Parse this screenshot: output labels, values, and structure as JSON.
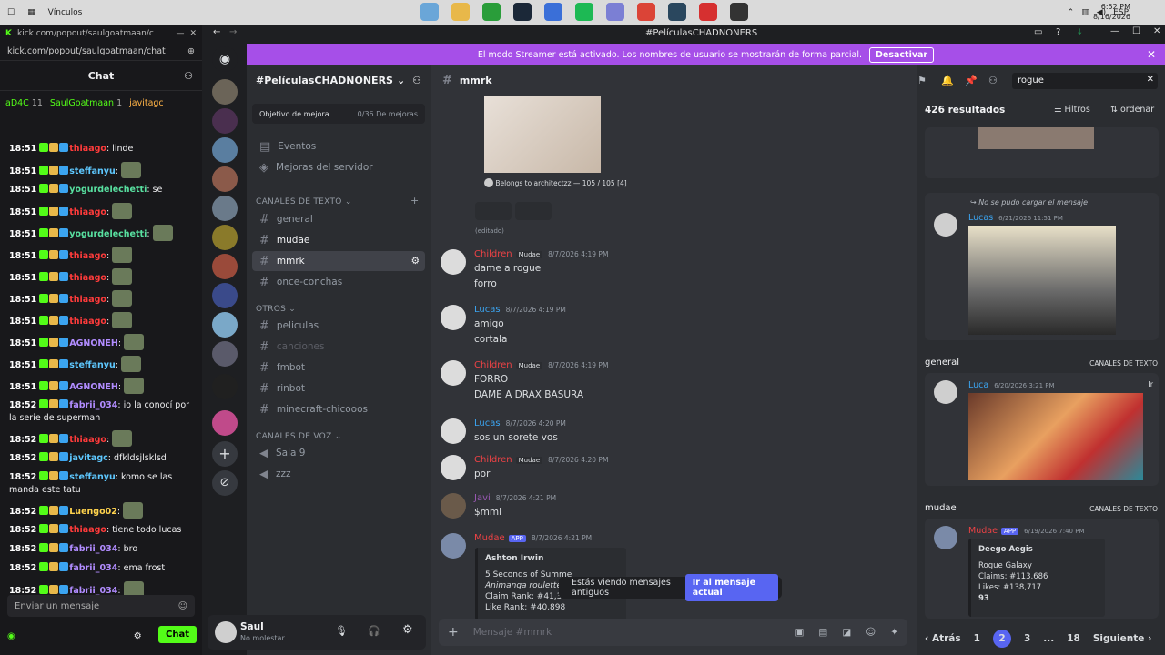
{
  "taskbar": {
    "links_label": "Vínculos",
    "lang": "ESP",
    "time": "6:52 PM",
    "date": "8/16/2026",
    "apps": [
      {
        "name": "photos",
        "color": "#6aa6d8"
      },
      {
        "name": "files",
        "color": "#e8b84a"
      },
      {
        "name": "xbox",
        "color": "#2a9d3a"
      },
      {
        "name": "steam",
        "color": "#1b2838"
      },
      {
        "name": "vpn",
        "color": "#3a6fd8"
      },
      {
        "name": "spotify",
        "color": "#1db954"
      },
      {
        "name": "discord",
        "color": "#7b7fd4"
      },
      {
        "name": "chrome",
        "color": "#db4437"
      },
      {
        "name": "steam2",
        "color": "#2a475e"
      },
      {
        "name": "app-red",
        "color": "#d63030"
      },
      {
        "name": "app-dark",
        "color": "#333333"
      }
    ]
  },
  "kick": {
    "url": "kick.com/popout/saulgoatmaan/chat",
    "header": "Chat",
    "pinned": [
      {
        "name": "aD4C",
        "count": "11"
      },
      {
        "name": "SaulGoatmaan",
        "count": "1"
      },
      {
        "name": "javitagc",
        "count": ""
      }
    ],
    "messages": [
      {
        "time": "18:51",
        "user": "thiaago",
        "ucolor": "#ff3b3b",
        "text": ": linde"
      },
      {
        "time": "18:51",
        "user": "steffanyu",
        "ucolor": "#5ec8ff",
        "text": ":"
      },
      {
        "time": "18:51",
        "user": "yogurdelechetti",
        "ucolor": "#58e0a0",
        "text": ": se"
      },
      {
        "time": "18:51",
        "user": "thiaago",
        "ucolor": "#ff3b3b",
        "text": ":"
      },
      {
        "time": "18:51",
        "user": "yogurdelechetti",
        "ucolor": "#58e0a0",
        "text": ":"
      },
      {
        "time": "18:51",
        "user": "thiaago",
        "ucolor": "#ff3b3b",
        "text": ":"
      },
      {
        "time": "18:51",
        "user": "thiaago",
        "ucolor": "#ff3b3b",
        "text": ":"
      },
      {
        "time": "18:51",
        "user": "thiaago",
        "ucolor": "#ff3b3b",
        "text": ":"
      },
      {
        "time": "18:51",
        "user": "thiaago",
        "ucolor": "#ff3b3b",
        "text": ":"
      },
      {
        "time": "18:51",
        "user": "AGNONEH",
        "ucolor": "#b18cff",
        "text": ":"
      },
      {
        "time": "18:51",
        "user": "steffanyu",
        "ucolor": "#5ec8ff",
        "text": ":"
      },
      {
        "time": "18:51",
        "user": "AGNONEH",
        "ucolor": "#b18cff",
        "text": ":"
      },
      {
        "time": "18:52",
        "user": "fabrii_034",
        "ucolor": "#b18cff",
        "text": ": io la conocí por la serie de superman"
      },
      {
        "time": "18:52",
        "user": "thiaago",
        "ucolor": "#ff3b3b",
        "text": ":"
      },
      {
        "time": "18:52",
        "user": "javitagc",
        "ucolor": "#5ec8ff",
        "text": ": dfkldsjlsklsd"
      },
      {
        "time": "18:52",
        "user": "steffanyu",
        "ucolor": "#5ec8ff",
        "text": ": komo se las manda este tatu"
      },
      {
        "time": "18:52",
        "user": "Luengo02",
        "ucolor": "#ffd34d",
        "text": ":"
      },
      {
        "time": "18:52",
        "user": "thiaago",
        "ucolor": "#ff3b3b",
        "text": ": tiene todo lucas"
      },
      {
        "time": "18:52",
        "user": "fabrii_034",
        "ucolor": "#b18cff",
        "text": ": bro"
      },
      {
        "time": "18:52",
        "user": "fabrii_034",
        "ucolor": "#b18cff",
        "text": ": ema frost"
      },
      {
        "time": "18:52",
        "user": "fabrii_034",
        "ucolor": "#b18cff",
        "text": ":"
      }
    ],
    "input_placeholder": "Enviar un mensaje",
    "chat_button": "Chat"
  },
  "discord": {
    "window_title": "#PelículasCHADNONERS",
    "streamer_banner": "El modo Streamer está activado. Los nombres de usuario se mostrarán de forma parcial.",
    "streamer_button": "Desactivar",
    "server_name": "#PelículasCHADNONERS",
    "goal_label": "Objetivo de mejora",
    "goal_value": "0/36 De mejoras",
    "top_items": [
      "Eventos",
      "Mejoras del servidor"
    ],
    "text_category": "CANALES DE TEXTO",
    "text_channels": [
      "general",
      "mudae",
      "mmrk",
      "once-conchas"
    ],
    "other_category": "OTROS",
    "other_channels": [
      "peliculas",
      "canciones",
      "fmbot",
      "rinbot",
      "minecraft-chicooos"
    ],
    "voice_category": "CANALES DE VOZ",
    "voice_channels": [
      "Sala 9",
      "zzz"
    ],
    "user": {
      "name": "Saul",
      "status": "No molestar"
    },
    "current_channel": "mmrk",
    "embed_footer": "Belongs to architectzz — 105 / 105 [4]",
    "edited": "(editado)",
    "messages": [
      {
        "author": "Children",
        "color": "#ed4245",
        "tag": "Mudae",
        "time": "8/7/2026 4:19 PM",
        "lines": [
          "dame a rogue",
          "forro"
        ]
      },
      {
        "author": "Lucas",
        "color": "#3ba4f0",
        "tag": "",
        "time": "8/7/2026 4:19 PM",
        "lines": [
          "amigo",
          "cortala"
        ]
      },
      {
        "author": "Children",
        "color": "#ed4245",
        "tag": "Mudae",
        "time": "8/7/2026 4:19 PM",
        "lines": [
          "FORRO",
          "DAME A DRAX BASURA"
        ]
      },
      {
        "author": "Lucas",
        "color": "#3ba4f0",
        "tag": "",
        "time": "8/7/2026 4:20 PM",
        "lines": [
          "sos un sorete vos"
        ]
      },
      {
        "author": "Children",
        "color": "#ed4245",
        "tag": "Mudae",
        "time": "8/7/2026 4:20 PM",
        "lines": [
          "por"
        ]
      },
      {
        "author": "Javi",
        "color": "#9b59b6",
        "tag": "",
        "time": "8/7/2026 4:21 PM",
        "lines": [
          "$mmi"
        ]
      },
      {
        "author": "Mudae",
        "color": "#ed4245",
        "tag": "APP",
        "time": "8/7/2026 4:21 PM",
        "lines": []
      }
    ],
    "mudae_embed": {
      "title": "Ashton Irwin",
      "lines": [
        "5 Seconds of Summe",
        "Animanga roulette · 1",
        "Claim Rank: #41,342",
        "Like Rank: #40,898"
      ]
    },
    "old_messages_notice": "Estás viendo mensajes antiguos",
    "old_messages_button": "Ir al mensaje actual",
    "composer_placeholder": "Mensaje #mmrk",
    "search": {
      "query": "rogue",
      "results": "426 resultados",
      "filters": "Filtros",
      "order": "ordenar",
      "reply_note": "No se pudo cargar el mensaje",
      "r1_author": "Lucas",
      "r1_time": "6/21/2026 11:51 PM",
      "section2": "general",
      "section3": "mudae",
      "section_tag": "CANALES DE TEXTO",
      "r2_author": "Luca",
      "r2_time": "6/20/2026 3:21 PM",
      "r2_jump": "Ir",
      "r3_author": "Mudae",
      "r3_tag": "APP",
      "r3_time": "6/19/2026 7:40 PM",
      "r3_embed": {
        "title": "Deego Aegis",
        "lines": [
          "Rogue Galaxy",
          "Claims: #113,686",
          "Likes: #138,717",
          "93"
        ]
      },
      "pagination": {
        "prev": "Atrás",
        "pages": [
          "1",
          "2",
          "3",
          "...",
          "18"
        ],
        "next": "Siguiente"
      }
    }
  }
}
